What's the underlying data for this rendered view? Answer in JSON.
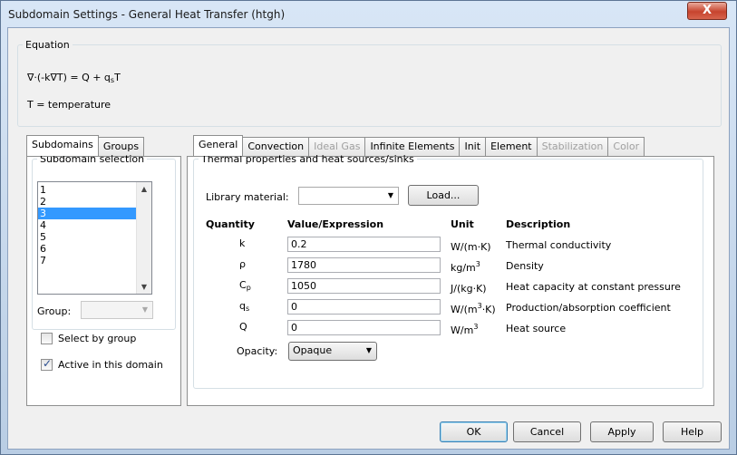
{
  "window": {
    "title": "Subdomain Settings - General Heat Transfer (htgh)",
    "close_label": "X"
  },
  "equation": {
    "legend": "Equation",
    "line1_pre": "∇·(-k∇T) = Q + q",
    "line1_sub": "s",
    "line1_post": "T",
    "line2": "T = temperature"
  },
  "left_tabs": [
    "Subdomains",
    "Groups"
  ],
  "subdomain_selection": {
    "legend": "Subdomain selection",
    "items": [
      "1",
      "2",
      "3",
      "4",
      "5",
      "6",
      "7"
    ],
    "selected": "3",
    "group_label": "Group:",
    "group_value": "",
    "select_by_group_label": "Select by group",
    "select_by_group_checked": false,
    "active_label": "Active in this domain",
    "active_checked": true
  },
  "right_tabs": [
    "General",
    "Convection",
    "Ideal Gas",
    "Infinite Elements",
    "Init",
    "Element",
    "Stabilization",
    "Color"
  ],
  "right_tabs_disabled": [
    "Ideal Gas",
    "Stabilization",
    "Color"
  ],
  "right_tabs_active": "General",
  "thermal": {
    "legend": "Thermal properties and heat sources/sinks",
    "library_label": "Library material:",
    "library_value": "",
    "load_label": "Load...",
    "headers": {
      "quantity": "Quantity",
      "value": "Value/Expression",
      "unit": "Unit",
      "description": "Description"
    },
    "rows": [
      {
        "symbol": "k",
        "symbol_sub": "",
        "value": "0.2",
        "unit": "W/(m·K)",
        "unit_sup": "",
        "unit_post": "",
        "description": "Thermal conductivity"
      },
      {
        "symbol": "ρ",
        "symbol_sub": "",
        "value": "1780",
        "unit": "kg/m",
        "unit_sup": "3",
        "unit_post": "",
        "description": "Density"
      },
      {
        "symbol": "C",
        "symbol_sub": "p",
        "value": "1050",
        "unit": "J/(kg·K)",
        "unit_sup": "",
        "unit_post": "",
        "description": "Heat capacity at constant pressure"
      },
      {
        "symbol": "q",
        "symbol_sub": "s",
        "value": "0",
        "unit": "W/(m",
        "unit_sup": "3",
        "unit_post": "·K)",
        "description": "Production/absorption coefficient"
      },
      {
        "symbol": "Q",
        "symbol_sub": "",
        "value": "0",
        "unit": "W/m",
        "unit_sup": "3",
        "unit_post": "",
        "description": "Heat source"
      }
    ],
    "opacity_label": "Opacity:",
    "opacity_value": "Opaque"
  },
  "buttons": {
    "ok": "OK",
    "cancel": "Cancel",
    "apply": "Apply",
    "help": "Help"
  },
  "icons": {
    "dropdown": "chevron-down-icon",
    "scroll_up": "scroll-up-arrow-icon",
    "scroll_down": "scroll-down-arrow-icon",
    "close": "close-icon",
    "check": "checkmark-icon"
  },
  "colors": {
    "selection": "#3399ff",
    "close_button": "#c7442e",
    "window_frame": "#c9d6e6"
  }
}
